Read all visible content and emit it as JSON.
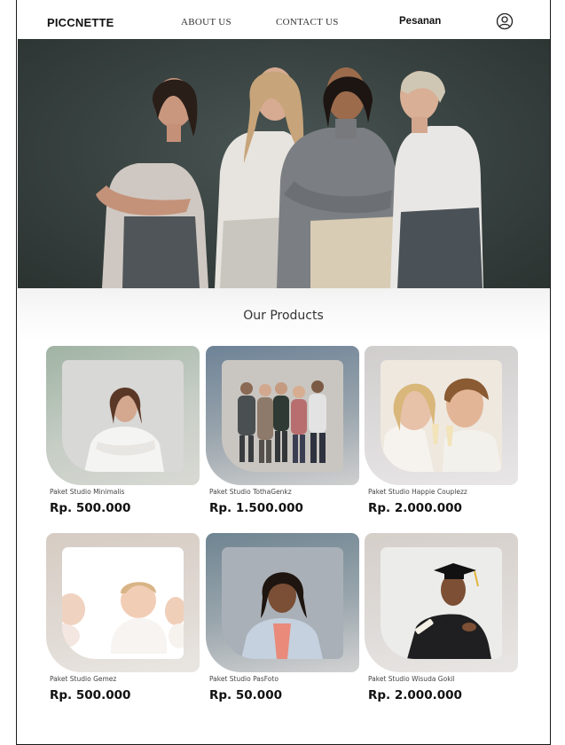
{
  "nav": {
    "brand": "PICCNETTE",
    "links": [
      "ABOUT US",
      "CONTACT US"
    ],
    "orders": "Pesanan",
    "account_icon": "user-circle-icon"
  },
  "hero": {
    "image": "group-of-four-women-photo"
  },
  "products": {
    "title": "Our Products",
    "items": [
      {
        "name": "Paket Studio Minimalis",
        "price": "Rp. 500.000",
        "bg": "#a6b5a8",
        "photo": "woman-arms-crossed-portrait"
      },
      {
        "name": "Paket Studio TothaGenkz",
        "price": "Rp. 1.500.000",
        "bg": "#7b8d9b",
        "photo": "family-group-portrait"
      },
      {
        "name": "Paket Studio Happie Couplezz",
        "price": "Rp. 2.000.000",
        "bg": "#d6d3d3",
        "photo": "couple-toasting-portrait"
      },
      {
        "name": "Paket Studio Gemez",
        "price": "Rp. 500.000",
        "bg": "#d9d1c9",
        "photo": "babies-crawling-portrait"
      },
      {
        "name": "Paket Studio PasFoto",
        "price": "Rp. 50.000",
        "bg": "#7d8f9a",
        "photo": "passport-headshot-portrait"
      },
      {
        "name": "Paket Studio Wisuda Gokil",
        "price": "Rp. 2.000.000",
        "bg": "#d8d4d0",
        "photo": "graduate-portrait"
      }
    ]
  }
}
